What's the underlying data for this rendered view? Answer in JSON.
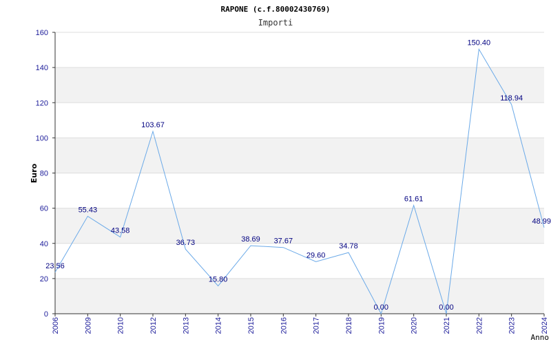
{
  "chart_data": {
    "type": "line",
    "title": "RAPONE (c.f.80002430769)",
    "subtitle": "Importi",
    "xlabel": "Anno",
    "ylabel": "Euro",
    "ylim": [
      0,
      160
    ],
    "y_ticks": [
      0,
      20,
      40,
      60,
      80,
      100,
      120,
      140,
      160
    ],
    "categories": [
      "2006",
      "2009",
      "2010",
      "2012",
      "2013",
      "2014",
      "2015",
      "2016",
      "2017",
      "2018",
      "2019",
      "2020",
      "2021",
      "2022",
      "2023",
      "2024"
    ],
    "values": [
      23.56,
      55.43,
      43.58,
      103.67,
      36.73,
      15.8,
      38.69,
      37.67,
      29.6,
      34.78,
      0.0,
      61.61,
      0.0,
      150.4,
      118.94,
      48.99
    ],
    "data_labels": [
      "23.56",
      "55.43",
      "43.58",
      "103.67",
      "36.73",
      "15.80",
      "38.69",
      "37.67",
      "29.60",
      "34.78",
      "0.00",
      "61.61",
      "0.00",
      "150.40",
      "118.94",
      "48.99"
    ],
    "grid": true,
    "colors": {
      "line": "#6aa9e8",
      "band": "#f2f2f2",
      "grid": "#dddddd",
      "axis": "#333333",
      "tick_text": "#1a1a99",
      "label_text": "#000080"
    }
  }
}
